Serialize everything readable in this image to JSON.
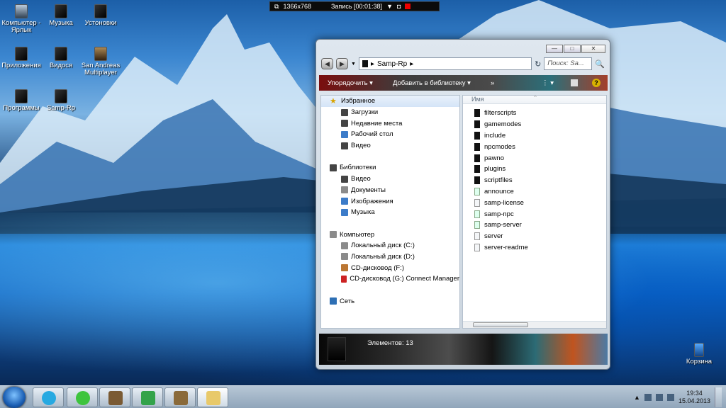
{
  "desktop": {
    "icons": [
      {
        "label": "Компьютер - Ярлык",
        "icon": "computer-icon"
      },
      {
        "label": "Музыка",
        "icon": "folder-icon"
      },
      {
        "label": "Устоновки",
        "icon": "folder-icon"
      },
      {
        "label": "Приложения",
        "icon": "folder-icon"
      },
      {
        "label": "Видося",
        "icon": "folder-icon"
      },
      {
        "label": "San Andreas Multiplayer",
        "icon": "samp-icon"
      },
      {
        "label": "Программы",
        "icon": "folder-icon"
      },
      {
        "label": "Samp-Rp",
        "icon": "folder-icon"
      },
      {
        "label": "Корзина",
        "icon": "recycle-bin-icon"
      }
    ]
  },
  "recorder": {
    "resolution": "1366x768",
    "status": "Запись [00:01:38]"
  },
  "explorer": {
    "breadcrumb": "Samp-Rp",
    "search_placeholder": "Поиск: Sa...",
    "toolbar": {
      "organize": "Упорядочить",
      "add_library": "Добавить в библиотеку",
      "more": "»"
    },
    "nav": {
      "favorites": {
        "label": "Избранное",
        "items": [
          "Загрузки",
          "Недавние места",
          "Рабочий стол",
          "Видео"
        ]
      },
      "libraries": {
        "label": "Библиотеки",
        "items": [
          "Видео",
          "Документы",
          "Изображения",
          "Музыка"
        ]
      },
      "computer": {
        "label": "Компьютер",
        "items": [
          "Локальный диск (C:)",
          "Локальный диск (D:)",
          "CD-дисковод (F:)",
          "CD-дисковод (G:) Connect Manager"
        ]
      },
      "network": {
        "label": "Сеть"
      }
    },
    "column_name": "Имя",
    "files": [
      {
        "name": "filterscripts",
        "type": "folder"
      },
      {
        "name": "gamemodes",
        "type": "folder"
      },
      {
        "name": "include",
        "type": "folder"
      },
      {
        "name": "npcmodes",
        "type": "folder"
      },
      {
        "name": "pawno",
        "type": "folder"
      },
      {
        "name": "plugins",
        "type": "folder"
      },
      {
        "name": "scriptfiles",
        "type": "folder"
      },
      {
        "name": "announce",
        "type": "app"
      },
      {
        "name": "samp-license",
        "type": "file"
      },
      {
        "name": "samp-npc",
        "type": "app"
      },
      {
        "name": "samp-server",
        "type": "app"
      },
      {
        "name": "server",
        "type": "file"
      },
      {
        "name": "server-readme",
        "type": "file"
      }
    ],
    "status": "Элементов: 13"
  },
  "taskbar": {
    "apps": [
      "skype-icon",
      "icq-icon",
      "samp-icon",
      "connect-manager-icon",
      "samp-icon",
      "explorer-icon"
    ],
    "time": "19:34",
    "date": "15.04.2013"
  }
}
